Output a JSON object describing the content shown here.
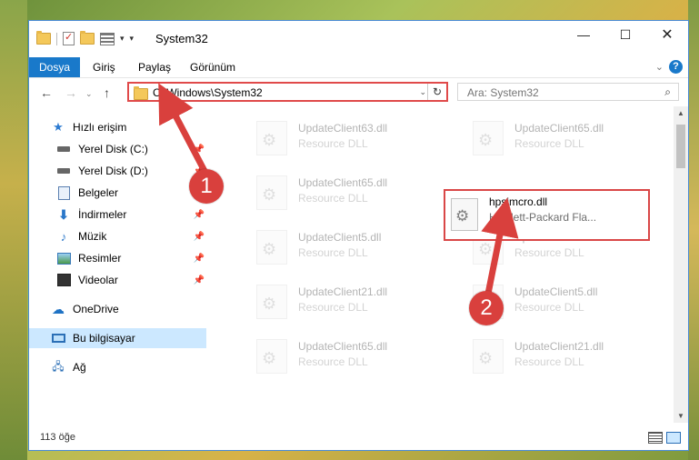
{
  "window": {
    "title": "System32"
  },
  "ribbon": {
    "tabs": [
      "Dosya",
      "Giriş",
      "Paylaş",
      "Görünüm"
    ]
  },
  "address": {
    "path": "C:\\Windows\\System32"
  },
  "search": {
    "placeholder": "Ara: System32"
  },
  "sidebar": {
    "items": [
      {
        "label": "Hızlı erişim",
        "icon": "star-icon"
      },
      {
        "label": "Yerel Disk (C:)",
        "icon": "drive-icon"
      },
      {
        "label": "Yerel Disk (D:)",
        "icon": "drive-icon"
      },
      {
        "label": "Belgeler",
        "icon": "documents-icon"
      },
      {
        "label": "İndirmeler",
        "icon": "download-icon"
      },
      {
        "label": "Müzik",
        "icon": "music-icon"
      },
      {
        "label": "Resimler",
        "icon": "pictures-icon"
      },
      {
        "label": "Videolar",
        "icon": "videos-icon"
      },
      {
        "label": "OneDrive",
        "icon": "cloud-icon"
      },
      {
        "label": "Bu bilgisayar",
        "icon": "computer-icon"
      },
      {
        "label": "Ağ",
        "icon": "network-icon"
      }
    ]
  },
  "files": [
    {
      "name": "UpdateClient63.dll",
      "type": "Resource DLL"
    },
    {
      "name": "UpdateClient65.dll",
      "type": "Resource DLL"
    },
    {
      "name": "UpdateClient65.dll",
      "type": "Resource DLL"
    },
    {
      "name": "UpdateClient5.dll",
      "type": "Resource DLL"
    },
    {
      "name": "UpdateClient5.dll",
      "type": "Resource DLL"
    },
    {
      "name": "UpdateClient21.dll",
      "type": "Resource DLL"
    },
    {
      "name": "UpdateClient5.dll",
      "type": "Resource DLL"
    },
    {
      "name": "UpdateClient65.dll",
      "type": "Resource DLL"
    },
    {
      "name": "UpdateClient21.dll",
      "type": "Resource DLL"
    }
  ],
  "highlighted_file": {
    "name": "hpsjmcro.dll",
    "type": "Hewlett-Packard Fla..."
  },
  "status": {
    "count": "113 öğe"
  },
  "callouts": [
    "1",
    "2"
  ],
  "colors": {
    "accent": "#1979ca",
    "annotation": "#d9403d",
    "selection": "#cce8ff"
  }
}
